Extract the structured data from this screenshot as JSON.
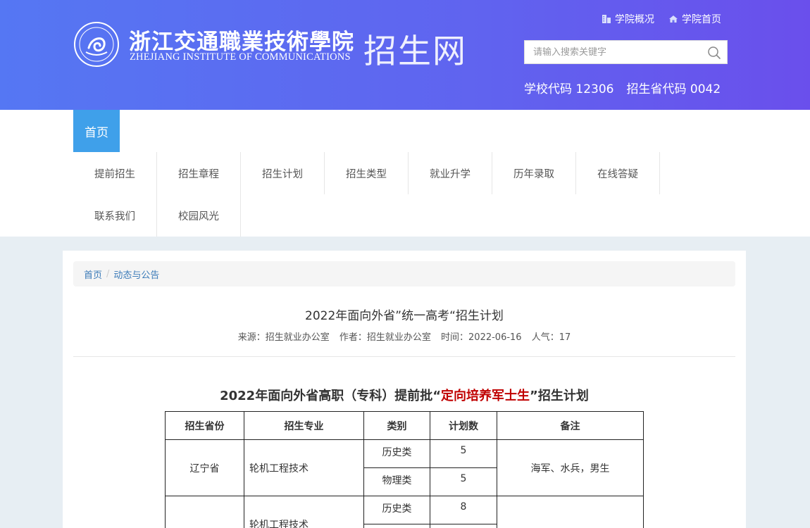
{
  "header": {
    "brand_cn": "浙江交通職業技術學院",
    "brand_en": "ZHEJIANG INSTITUTE OF COMMUNICATIONS",
    "site_name": "招生网",
    "top_links": [
      {
        "label": "学院概况",
        "icon": "building-icon"
      },
      {
        "label": "学院首页",
        "icon": "home-icon"
      }
    ],
    "search": {
      "placeholder": "请输入搜索关键字",
      "value": ""
    },
    "school_code": "学校代码 12306",
    "province_code": "招生省代码 0042"
  },
  "nav": {
    "home": "首页",
    "row1": [
      "提前招生",
      "招生章程",
      "招生计划",
      "招生类型",
      "就业升学",
      "历年录取",
      "在线答疑"
    ],
    "row2": [
      "联系我们",
      "校园风光"
    ]
  },
  "breadcrumb": {
    "home": "首页",
    "sep": "/",
    "current": "动态与公告"
  },
  "article": {
    "title": "2022年面向外省”统一高考“招生计划",
    "meta": {
      "source": "来源：招生就业办公室",
      "author": "作者：招生就业办公室",
      "time": "时间：2022-06-16",
      "views": "人气：17"
    }
  },
  "plan_table": {
    "title_before": "2022年面向外省高职（专科）提前批“",
    "title_highlight": "定向培养军士生",
    "title_after": "”招生计划",
    "headers": [
      "招生省份",
      "招生专业",
      "类别",
      "计划数",
      "备注"
    ],
    "rows": [
      {
        "province": "辽宁省",
        "major": "轮机工程技术",
        "cat1": "历史类",
        "num1": "5",
        "cat2": "物理类",
        "num2": "5",
        "note": "海军、水兵，男生"
      },
      {
        "province": "",
        "major": "轮机工程技术",
        "cat1": "历史类",
        "num1": "8",
        "cat2": "",
        "num2": "",
        "note": ""
      }
    ]
  },
  "colors": {
    "header_start": "#5577f3",
    "header_end": "#6a4fec",
    "accent_blue": "#3fa0ea",
    "highlight_red": "#c00000"
  }
}
